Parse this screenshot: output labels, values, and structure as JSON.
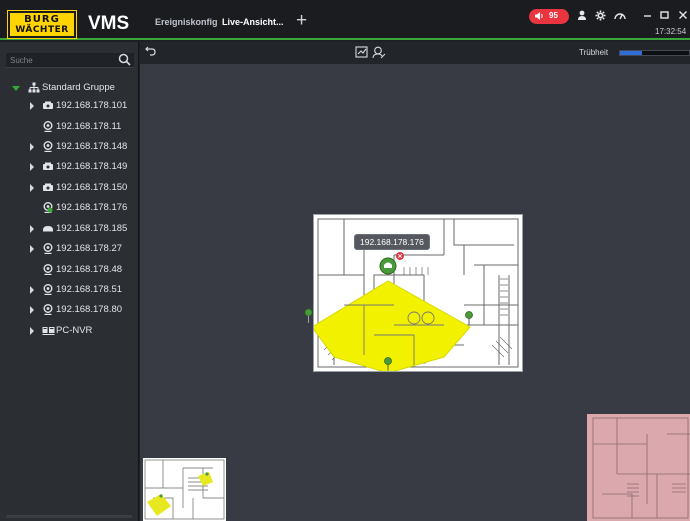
{
  "header": {
    "logo_line1": "BURG",
    "logo_line2": "WÄCHTER",
    "app_title": "VMS",
    "tabs": [
      {
        "label": "Ereigniskonfig",
        "active": false
      },
      {
        "label": "Live-Ansicht...",
        "active": true
      }
    ],
    "add_tab_label": "+",
    "alarm_count": "95",
    "clock": "17:32:54",
    "icons": [
      "speaker-icon",
      "user-icon",
      "gear-icon",
      "gauge-icon",
      "minimize-icon",
      "maximize-icon",
      "close-icon"
    ]
  },
  "sidebar": {
    "search_placeholder": "Suche",
    "tree": [
      {
        "label": "Standard Gruppe",
        "icon": "group-icon",
        "level": 0,
        "expanded": true
      },
      {
        "label": "192.168.178.101",
        "icon": "box-camera-icon",
        "level": 1,
        "expandable": true,
        "online": false
      },
      {
        "label": "192.168.178.11",
        "icon": "dome-camera-icon",
        "level": 1,
        "expandable": false,
        "online": false
      },
      {
        "label": "192.168.178.148",
        "icon": "dome-camera-icon",
        "level": 1,
        "expandable": true,
        "online": false
      },
      {
        "label": "192.168.178.149",
        "icon": "box-camera-icon",
        "level": 1,
        "expandable": true,
        "online": false
      },
      {
        "label": "192.168.178.150",
        "icon": "box-camera-icon",
        "level": 1,
        "expandable": true,
        "online": false
      },
      {
        "label": "192.168.178.176",
        "icon": "dome-camera-icon",
        "level": 1,
        "expandable": false,
        "online": true
      },
      {
        "label": "192.168.178.185",
        "icon": "bullet-camera-icon",
        "level": 1,
        "expandable": true,
        "online": false
      },
      {
        "label": "192.168.178.27",
        "icon": "dome-camera-icon",
        "level": 1,
        "expandable": true,
        "online": false
      },
      {
        "label": "192.168.178.48",
        "icon": "dome-camera-icon",
        "level": 1,
        "expandable": false,
        "online": false
      },
      {
        "label": "192.168.178.51",
        "icon": "dome-camera-icon",
        "level": 1,
        "expandable": true,
        "online": false
      },
      {
        "label": "192.168.178.80",
        "icon": "dome-camera-icon",
        "level": 1,
        "expandable": true,
        "online": false
      },
      {
        "label": "PC-NVR",
        "icon": "nvr-icon",
        "level": 1,
        "expandable": true,
        "online": false
      }
    ]
  },
  "toolbar": {
    "turbidity_label": "Trübheit",
    "turbidity_level": 0.32
  },
  "map": {
    "camera_tooltip": "192.168.178.176"
  },
  "colors": {
    "accent": "#3aa63a",
    "alarm": "#e8353f",
    "coverage": "#f2f200",
    "logo": "#ffd400"
  }
}
